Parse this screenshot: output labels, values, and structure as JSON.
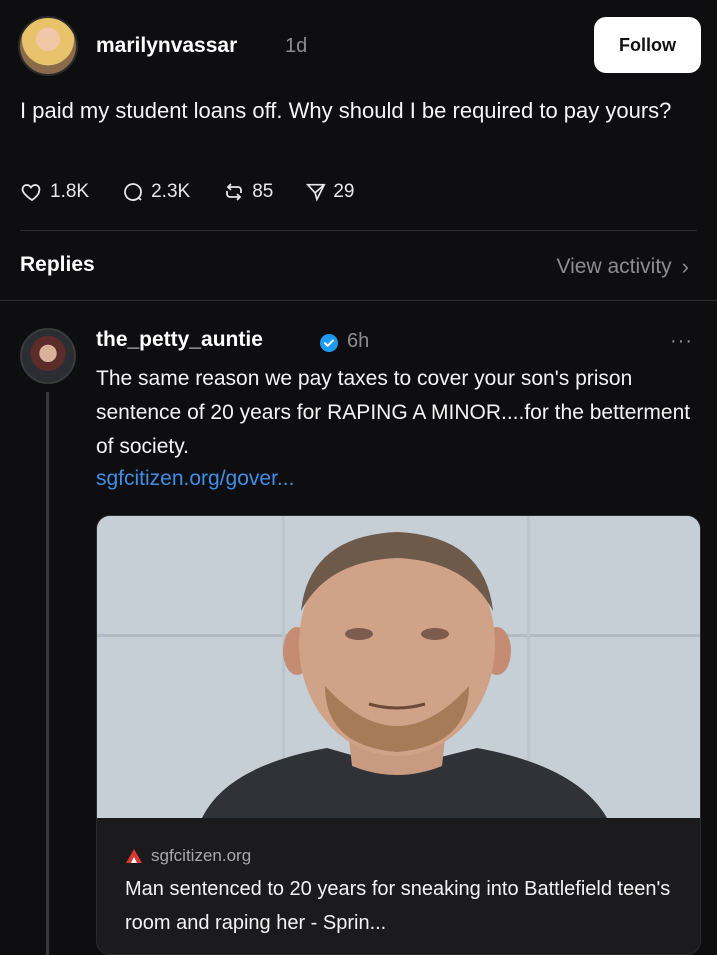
{
  "post": {
    "username": "marilynvassar",
    "time": "1d",
    "follow_label": "Follow",
    "text": "I paid my student loans off. Why should I be required to pay yours?",
    "stats": {
      "likes": "1.8K",
      "comments": "2.3K",
      "reposts": "85",
      "shares": "29"
    }
  },
  "replies_header": {
    "label": "Replies",
    "view_activity": "View activity",
    "chevron": "›"
  },
  "reply": {
    "username": "the_petty_auntie",
    "time": "6h",
    "more": "···",
    "text": "The same reason we pay taxes to cover your son's prison sentence of 20 years for RAPING A MINOR....for the betterment of society.",
    "link": "sgfcitizen.org/gover...",
    "card": {
      "domain": "sgfcitizen.org",
      "title": "Man sentenced to 20 years for sneaking into Battlefield teen's room and raping her - Sprin...",
      "image_icon": "mugshot-photo"
    }
  },
  "icons": {
    "like": "heart-icon",
    "comment": "comment-icon",
    "repost": "repost-icon",
    "share": "share-icon",
    "verified": "verified-badge-icon",
    "more": "more-icon"
  },
  "colors": {
    "background": "#0e0e10",
    "link": "#3e8ee8",
    "verified": "#1d9bf0",
    "muted": "#8d8d8d"
  }
}
